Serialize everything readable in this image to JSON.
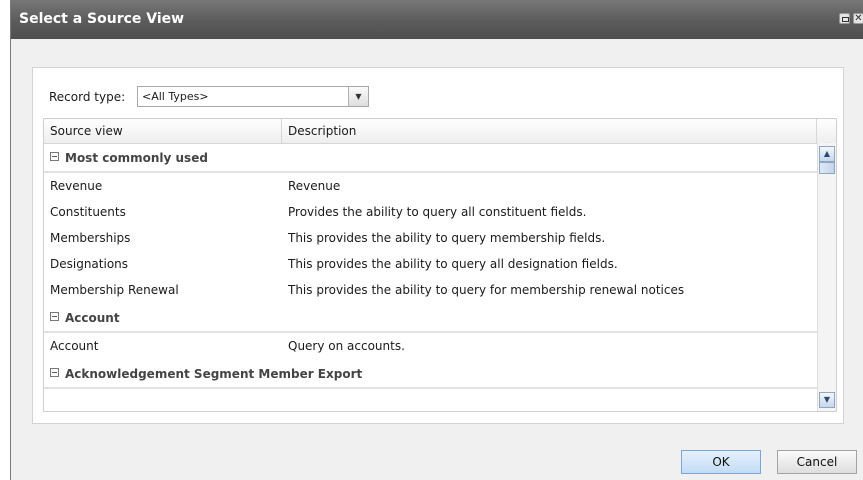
{
  "dialog": {
    "title": "Select a Source View",
    "icons": [
      "restore-icon",
      "close-icon"
    ]
  },
  "record_type": {
    "label": "Record type:",
    "selected": "<All Types>"
  },
  "grid": {
    "columns": [
      "Source view",
      "Description"
    ],
    "groups": [
      {
        "name": "Most commonly used",
        "rows": [
          {
            "source": "Revenue",
            "description": "Revenue"
          },
          {
            "source": "Constituents",
            "description": "Provides the ability to query all constituent fields."
          },
          {
            "source": "Memberships",
            "description": "This provides the ability to query membership fields."
          },
          {
            "source": "Designations",
            "description": "This provides the ability to query all designation fields."
          },
          {
            "source": "Membership Renewal",
            "description": "This provides the ability to query for membership renewal notices"
          }
        ]
      },
      {
        "name": "Account",
        "rows": [
          {
            "source": "Account",
            "description": "Query on accounts."
          }
        ]
      },
      {
        "name": "Acknowledgement Segment Member Export",
        "rows": []
      }
    ]
  },
  "buttons": {
    "ok": "OK",
    "cancel": "Cancel"
  }
}
